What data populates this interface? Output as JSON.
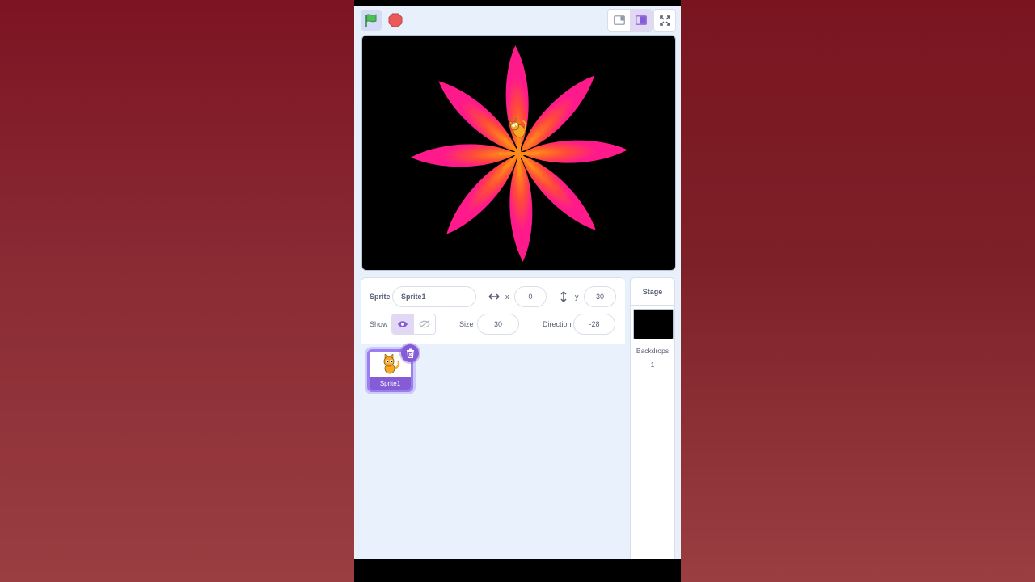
{
  "colors": {
    "accent": "#855cd6",
    "flag_green": "#4cbf56",
    "stop_red": "#ec5959",
    "petal_pink": "#ff1a8c",
    "petal_orange": "#ff8a1a",
    "stage_bg": "#000000"
  },
  "toolbar": {
    "green_flag_icon": "green-flag-icon",
    "stop_icon": "stop-sign-icon",
    "small_stage_icon": "small-stage-icon",
    "normal_stage_icon": "normal-stage-icon",
    "fullscreen_icon": "fullscreen-icon"
  },
  "sprite_info": {
    "sprite_label": "Sprite",
    "sprite_name": "Sprite1",
    "x_label": "x",
    "x_value": "0",
    "y_label": "y",
    "y_value": "30",
    "show_label": "Show",
    "size_label": "Size",
    "size_value": "30",
    "direction_label": "Direction",
    "direction_value": "-28"
  },
  "sprites": [
    {
      "name": "Sprite1",
      "selected": true
    }
  ],
  "stage_panel": {
    "title": "Stage",
    "backdrops_label": "Backdrops",
    "backdrops_count": "1"
  }
}
